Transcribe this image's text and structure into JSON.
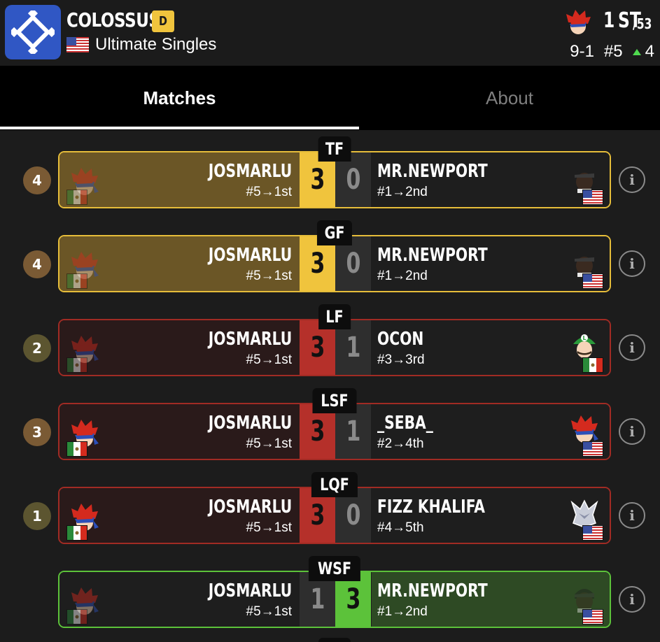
{
  "header": {
    "event_name": "COLOSSUS",
    "tier": "D",
    "game": "Ultimate Singles",
    "placement": "1",
    "placement_suffix": "ST",
    "entrants": "/53",
    "record": "9-1",
    "seed": "#5",
    "seed_delta": "4"
  },
  "tabs": {
    "matches": "Matches",
    "about": "About"
  },
  "colors": {
    "gold": "#f0c43d",
    "red": "#b5302a",
    "green": "#5cc23a",
    "bg": "#1c1c1c"
  },
  "matches": [
    {
      "round": "TF",
      "badge": "4",
      "p1": {
        "name": "JOSMARLU",
        "seed": "#5→1st",
        "score": "3",
        "flag": "mx",
        "char": "roy-icon"
      },
      "p2": {
        "name": "MR.NEWPORT",
        "seed": "#1→2nd",
        "score": "0",
        "flag": "us",
        "char": "terry-icon"
      },
      "style": "gold",
      "winner": "p1",
      "info": "i"
    },
    {
      "round": "GF",
      "badge": "4",
      "p1": {
        "name": "JOSMARLU",
        "seed": "#5→1st",
        "score": "3",
        "flag": "mx",
        "char": "roy-icon"
      },
      "p2": {
        "name": "MR.NEWPORT",
        "seed": "#1→2nd",
        "score": "0",
        "flag": "us",
        "char": "terry-icon"
      },
      "style": "gold",
      "winner": "p1",
      "info": "i"
    },
    {
      "round": "LF",
      "badge": "2",
      "p1": {
        "name": "JOSMARLU",
        "seed": "#5→1st",
        "score": "3",
        "flag": "mx",
        "char": "roy-icon"
      },
      "p2": {
        "name": "OCON",
        "seed": "#3→3rd",
        "score": "1",
        "flag": "mx",
        "char": "luigi-icon"
      },
      "style": "red-dark",
      "winner": "p1",
      "info": "i"
    },
    {
      "round": "LSF",
      "badge": "3",
      "p1": {
        "name": "JOSMARLU",
        "seed": "#5→1st",
        "score": "3",
        "flag": "mx",
        "char": "roy-icon"
      },
      "p2": {
        "name": "_SEBA_",
        "seed": "#2→4th",
        "score": "1",
        "flag": "us",
        "char": "roy-icon"
      },
      "style": "red",
      "winner": "p1",
      "info": "i"
    },
    {
      "round": "LQF",
      "badge": "1",
      "p1": {
        "name": "JOSMARLU",
        "seed": "#5→1st",
        "score": "3",
        "flag": "mx",
        "char": "roy-icon"
      },
      "p2": {
        "name": "FIZZ KHALIFA",
        "seed": "#4→5th",
        "score": "0",
        "flag": "us",
        "char": "wolf-icon"
      },
      "style": "red",
      "winner": "p1",
      "info": "i"
    },
    {
      "round": "WSF",
      "badge": "",
      "p1": {
        "name": "JOSMARLU",
        "seed": "#5→1st",
        "score": "1",
        "flag": "mx",
        "char": "roy-icon"
      },
      "p2": {
        "name": "MR.NEWPORT",
        "seed": "#1→2nd",
        "score": "3",
        "flag": "us",
        "char": "terry-icon"
      },
      "style": "green",
      "winner": "p2",
      "info": "i"
    }
  ]
}
